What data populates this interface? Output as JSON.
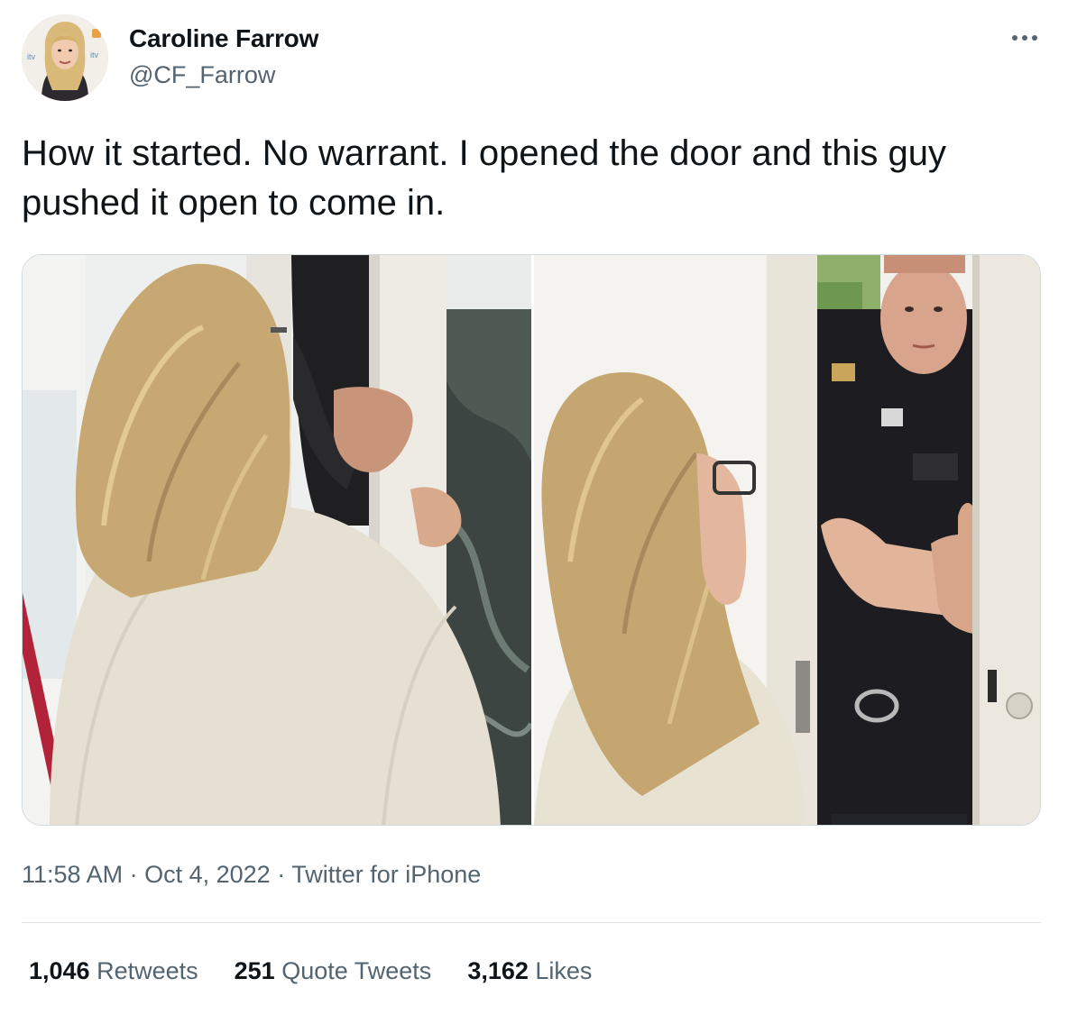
{
  "author": {
    "display_name": "Caroline Farrow",
    "handle": "@CF_Farrow",
    "avatar_icon": "profile-photo"
  },
  "tweet": {
    "text": "How it started. No warrant. I opened the door and this guy pushed it open to come in.",
    "more_icon": "more-horizontal-icon"
  },
  "media": {
    "photo_count": 2
  },
  "meta": {
    "time": "11:58 AM",
    "separator": "·",
    "date": "Oct 4, 2022",
    "source": "Twitter for iPhone"
  },
  "stats": {
    "retweets_count": "1,046",
    "retweets_label": "Retweets",
    "quotes_count": "251",
    "quotes_label": "Quote Tweets",
    "likes_count": "3,162",
    "likes_label": "Likes"
  },
  "colors": {
    "text_primary": "#0f1419",
    "text_secondary": "#536471",
    "border": "#cfd9de"
  }
}
